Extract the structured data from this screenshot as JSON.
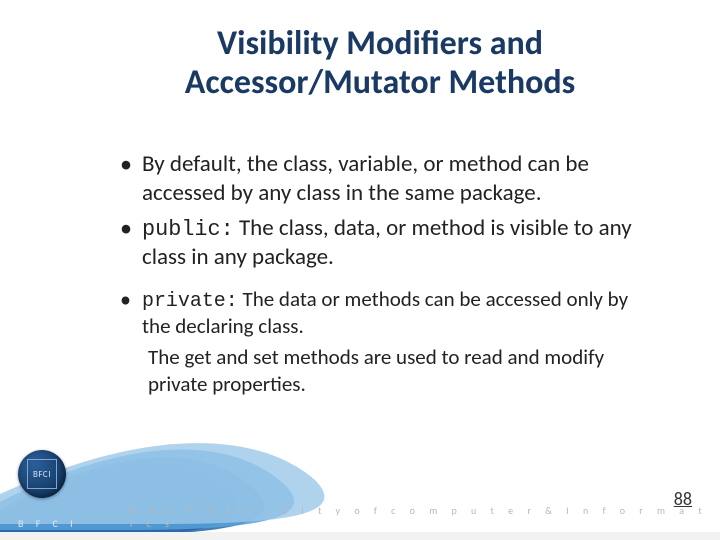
{
  "title": "Visibility Modifiers and Accessor/Mutator Methods",
  "bullets": {
    "b1": "By default, the class, variable, or method can be accessed by any class in the same package.",
    "b2_kw": "public:",
    "b2_rest": " The class, data, or method is visible to any class in any package.",
    "b3_kw": "private:",
    "b3_rest": " The data or methods can be accessed only by the declaring class.",
    "b3_extra": "The get and set methods are used to read and modify private properties."
  },
  "footer": {
    "institution": "B e n h a   f a c u l t y   o f   c o m p u t e r   &   I n f o r m a t i c s",
    "acronym": "B  F  C  I",
    "badge": "BFCI"
  },
  "page_number": "88"
}
